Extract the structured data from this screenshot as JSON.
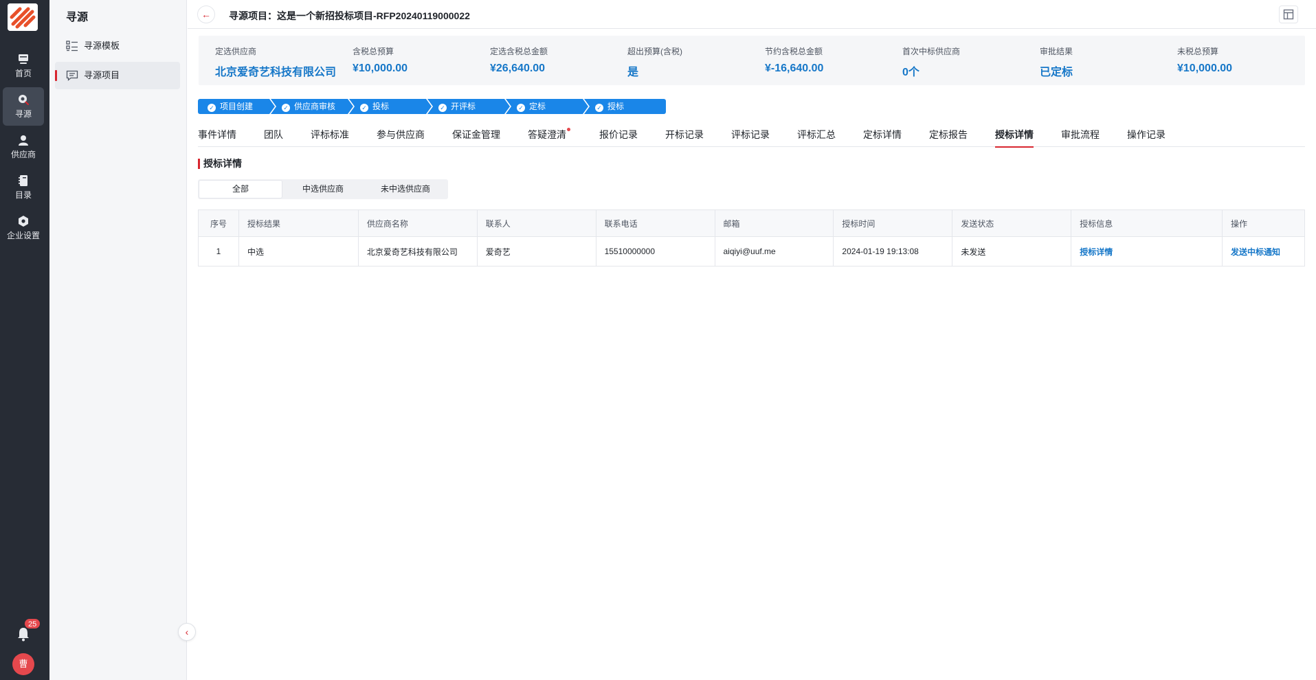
{
  "rail": {
    "items": [
      {
        "label": "首页",
        "icon": "monitor-icon"
      },
      {
        "label": "寻源",
        "icon": "sourcing-icon"
      },
      {
        "label": "供应商",
        "icon": "user-icon"
      },
      {
        "label": "目录",
        "icon": "catalog-icon"
      },
      {
        "label": "企业设置",
        "icon": "gear-icon"
      }
    ],
    "notification_count": "25",
    "avatar_text": "曹"
  },
  "sidebar": {
    "title": "寻源",
    "items": [
      {
        "label": "寻源模板",
        "icon": "template-icon"
      },
      {
        "label": "寻源项目",
        "icon": "project-icon"
      }
    ]
  },
  "header": {
    "title": "寻源项目：这是一个新招投标项目-RFP20240119000022"
  },
  "stats": [
    {
      "label": "定选供应商",
      "value": "北京爱奇艺科技有限公司"
    },
    {
      "label": "含税总预算",
      "value": "¥10,000.00"
    },
    {
      "label": "定选含税总金额",
      "value": "¥26,640.00"
    },
    {
      "label": "超出预算(含税)",
      "value": "是"
    },
    {
      "label": "节约含税总金额",
      "value": "¥-16,640.00"
    },
    {
      "label": "首次中标供应商",
      "value": "0个"
    },
    {
      "label": "审批结果",
      "value": "已定标"
    },
    {
      "label": "未税总预算",
      "value": "¥10,000.00"
    }
  ],
  "steps": [
    "项目创建",
    "供应商审核",
    "投标",
    "开评标",
    "定标",
    "授标"
  ],
  "tabs": [
    "事件详情",
    "团队",
    "评标标准",
    "参与供应商",
    "保证金管理",
    "答疑澄清",
    "报价记录",
    "开标记录",
    "评标记录",
    "评标汇总",
    "定标详情",
    "定标报告",
    "授标详情",
    "审批流程",
    "操作记录"
  ],
  "active_tab": "授标详情",
  "section": {
    "title": "授标详情",
    "filters": [
      "全部",
      "中选供应商",
      "未中选供应商"
    ]
  },
  "table": {
    "headers": [
      "序号",
      "授标结果",
      "供应商名称",
      "联系人",
      "联系电话",
      "邮箱",
      "授标时间",
      "发送状态",
      "授标信息",
      "操作"
    ],
    "rows": [
      {
        "index": "1",
        "result": "中选",
        "supplier": "北京爱奇艺科技有限公司",
        "contact": "爱奇艺",
        "phone": "15510000000",
        "email": "aiqiyi@uuf.me",
        "time": "2024-01-19 19:13:08",
        "send_status": "未发送",
        "info_link": "授标详情",
        "action_link": "发送中标通知"
      }
    ]
  },
  "colors": {
    "accent": "#d8262f",
    "primary_blue": "#1a86e8",
    "value_blue": "#1677c8",
    "rail_bg": "#272c35"
  }
}
